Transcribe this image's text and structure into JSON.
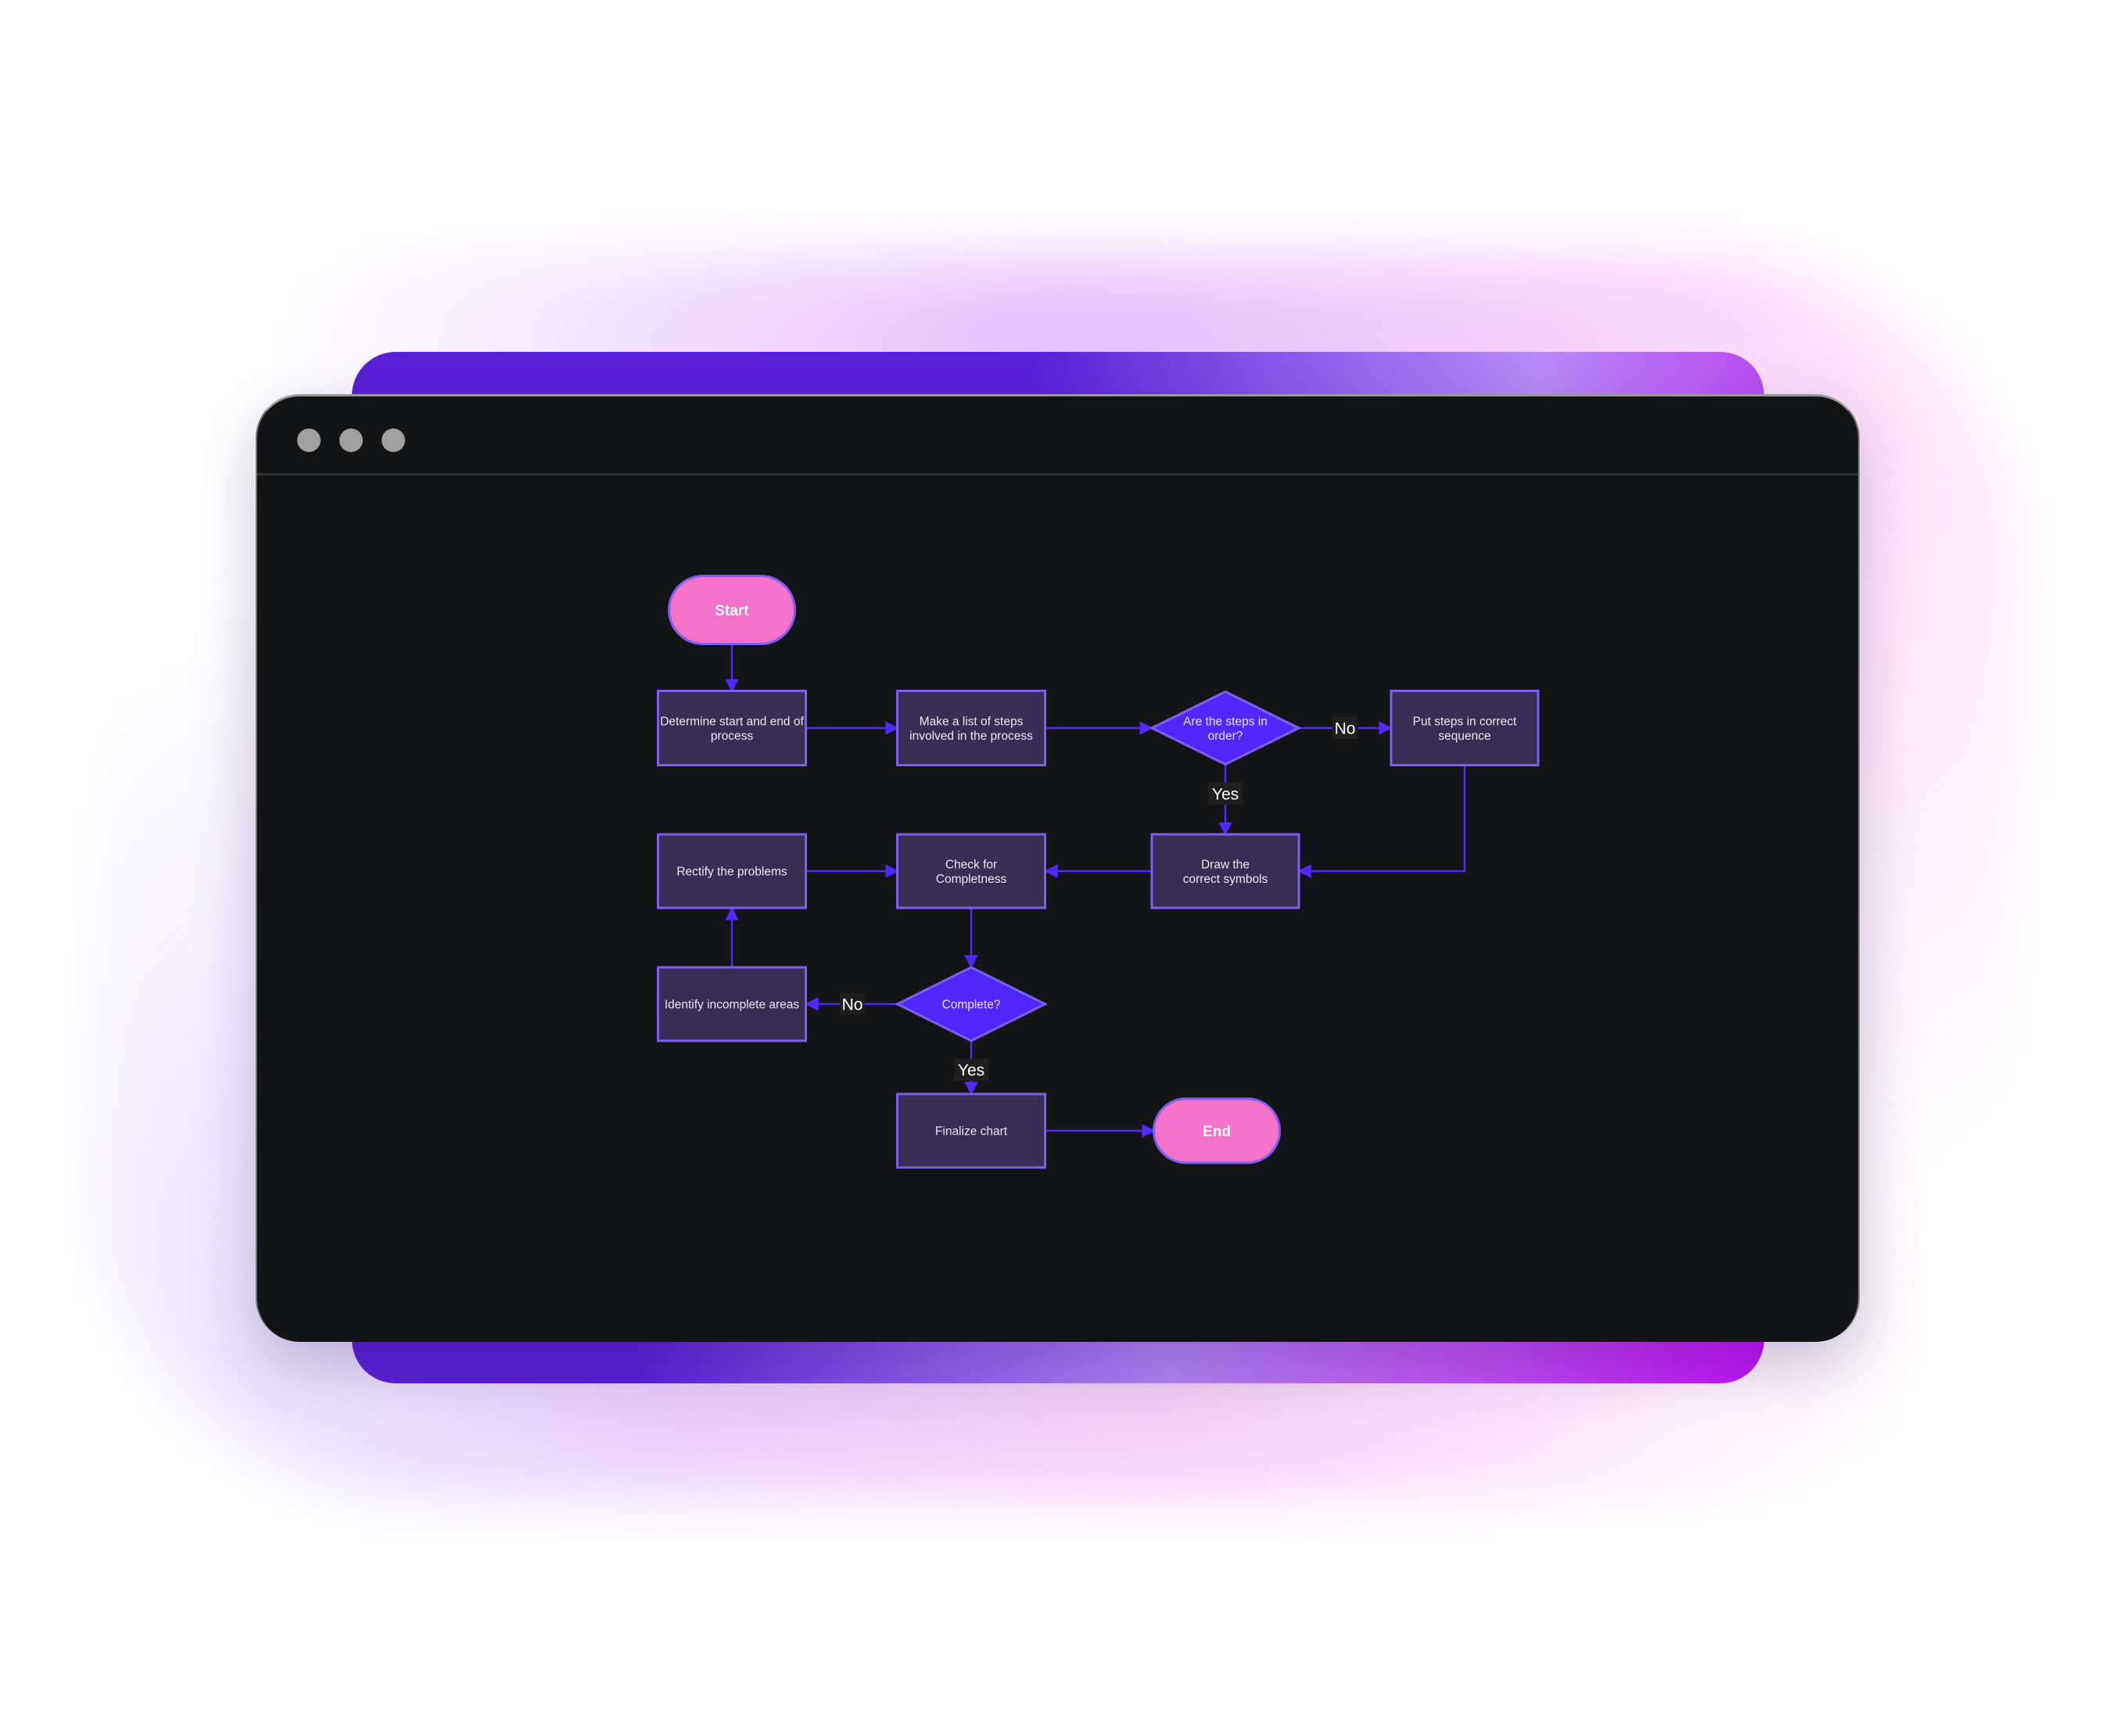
{
  "window": {
    "controls": [
      "close",
      "minimize",
      "maximize"
    ]
  },
  "colors": {
    "terminal_fill": "#f472c9",
    "process_fill": "#382e55",
    "decision_fill": "#5227fb",
    "node_stroke": "#7b5ef0",
    "edge": "#5227fb",
    "canvas": "#131416"
  },
  "flowchart": {
    "nodes": {
      "start": {
        "type": "terminal",
        "label": "Start"
      },
      "determine": {
        "type": "process",
        "lines": [
          "Determine start and end of",
          "process"
        ]
      },
      "list_steps": {
        "type": "process",
        "lines": [
          "Make a list of steps",
          "involved in the process"
        ]
      },
      "in_order": {
        "type": "decision",
        "lines": [
          "Are the steps in",
          "order?"
        ]
      },
      "put_steps": {
        "type": "process",
        "lines": [
          "Put steps in correct",
          "sequence"
        ]
      },
      "draw": {
        "type": "process",
        "lines": [
          "Draw the",
          "correct symbols"
        ]
      },
      "check": {
        "type": "process",
        "lines": [
          "Check for",
          "Completness"
        ]
      },
      "rectify": {
        "type": "process",
        "lines": [
          "Rectify the problems"
        ]
      },
      "identify": {
        "type": "process",
        "lines": [
          "Identify incomplete areas"
        ]
      },
      "complete": {
        "type": "decision",
        "lines": [
          "Complete?"
        ]
      },
      "finalize": {
        "type": "process",
        "lines": [
          "Finalize chart"
        ]
      },
      "end": {
        "type": "terminal",
        "label": "End"
      }
    },
    "edges": [
      {
        "from": "start",
        "to": "determine",
        "label": ""
      },
      {
        "from": "determine",
        "to": "list_steps",
        "label": ""
      },
      {
        "from": "list_steps",
        "to": "in_order",
        "label": ""
      },
      {
        "from": "in_order",
        "to": "put_steps",
        "label": "No"
      },
      {
        "from": "in_order",
        "to": "draw",
        "label": "Yes"
      },
      {
        "from": "put_steps",
        "to": "draw",
        "label": ""
      },
      {
        "from": "draw",
        "to": "check",
        "label": ""
      },
      {
        "from": "rectify",
        "to": "check",
        "label": ""
      },
      {
        "from": "check",
        "to": "complete",
        "label": ""
      },
      {
        "from": "complete",
        "to": "identify",
        "label": "No"
      },
      {
        "from": "identify",
        "to": "rectify",
        "label": ""
      },
      {
        "from": "complete",
        "to": "finalize",
        "label": "Yes"
      },
      {
        "from": "finalize",
        "to": "end",
        "label": ""
      }
    ]
  }
}
